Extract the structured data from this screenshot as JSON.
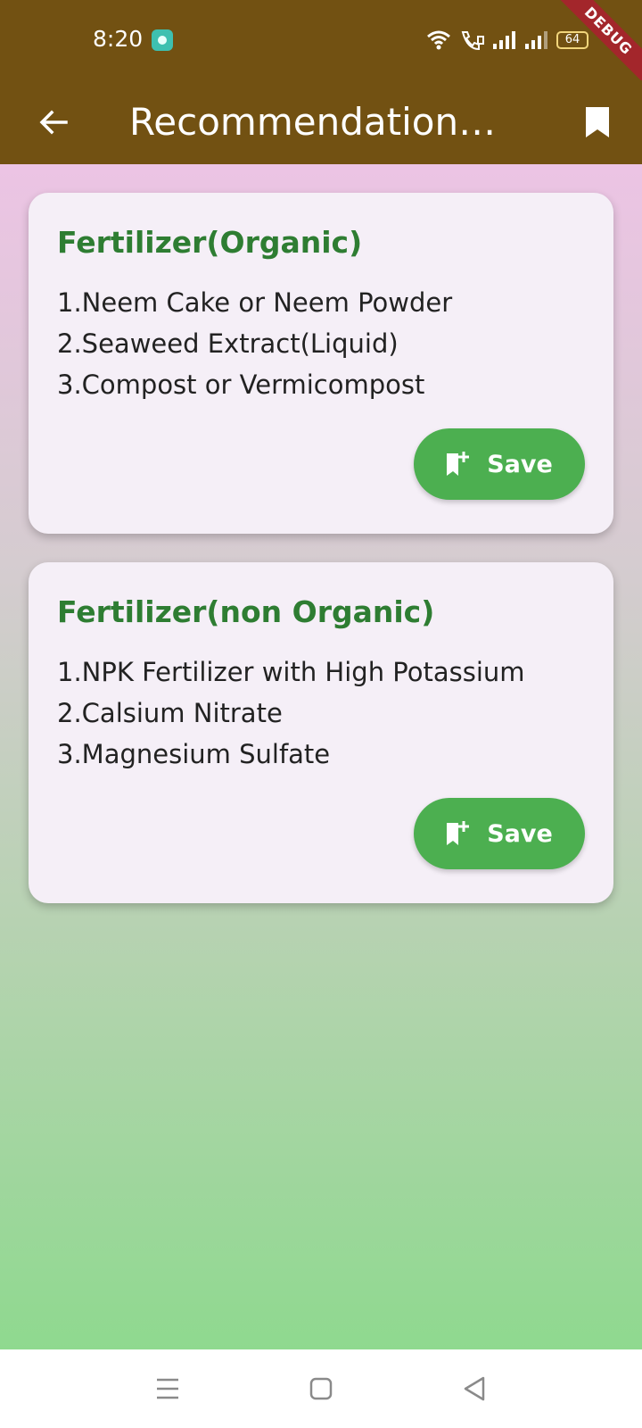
{
  "status_bar": {
    "time": "8:20",
    "battery_level": "64",
    "icons": [
      "app-notification-icon",
      "wifi-icon",
      "wifi-calling-icon",
      "signal-icon",
      "signal-icon",
      "battery-icon"
    ]
  },
  "debug_banner": {
    "label": "DEBUG"
  },
  "app_bar": {
    "title": "Recommendations for",
    "back_icon": "arrow-back-icon",
    "bookmarks_icon": "bookmark-icon"
  },
  "cards": [
    {
      "title": "Fertilizer(Organic)",
      "items": [
        "1.Neem Cake or Neem Powder",
        "2.Seaweed Extract(Liquid)",
        "3.Compost or Vermicompost"
      ],
      "save_label": "Save",
      "save_icon": "bookmark-add-icon"
    },
    {
      "title": "Fertilizer(non Organic)",
      "items": [
        "1.NPK Fertilizer with High Potassium",
        "2.Calsium Nitrate",
        "3.Magnesium Sulfate"
      ],
      "save_label": "Save",
      "save_icon": "bookmark-add-icon"
    }
  ],
  "nav_bar": {
    "icons": [
      "menu-icon",
      "home-square-icon",
      "back-triangle-icon"
    ]
  },
  "colors": {
    "app_bar": "#725112",
    "card_title": "#2e7d32",
    "save_button": "#4caf50",
    "card_background": "#f5eff7",
    "debug_banner": "#a3262b"
  }
}
